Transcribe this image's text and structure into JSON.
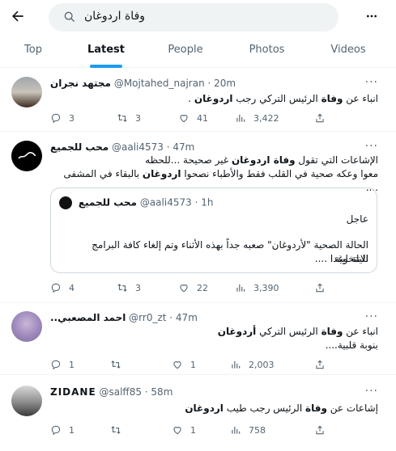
{
  "search": {
    "query": "وفاة اردوغان"
  },
  "tabs": [
    {
      "label": "Top"
    },
    {
      "label": "Latest"
    },
    {
      "label": "People"
    },
    {
      "label": "Photos"
    },
    {
      "label": "Videos"
    }
  ],
  "colors": {
    "accent": "#1d9bf0",
    "text": "#0f1419",
    "muted": "#536471"
  },
  "tweets": [
    {
      "name": "مجتهد نجران",
      "handle": "@Mojtahed_najran",
      "time": "· 20m",
      "text_parts": [
        "انباء عن ",
        "وفاة",
        " الرئيس التركي رجب ",
        "اردوغان",
        " ."
      ],
      "replies": "3",
      "retweets": "3",
      "likes": "41",
      "views": "3,422"
    },
    {
      "name": "محب للجميع",
      "handle": "@aali4573",
      "time": "· 47m",
      "text_parts": [
        "الإشاعات التي تقول ",
        "وفاة اردوغان",
        " غير صحيحة ...للحظه",
        "معوا وعكه صحية في القلب فقط والأطباء نصحوا ",
        "اردوغان",
        " بالبقاء في المشفى ...."
      ],
      "quote": {
        "name": "محب للجميع",
        "handle": "@aali4573",
        "time": "· 1h",
        "line1": "عاجل",
        "line2": "الحالة الصحية \"لأردوغان\"  صعبه جداً بهذه الأثناء وتم إلغاء كافة البرامج الانتخابية",
        "line3": "لليلة وغدا ...."
      },
      "replies": "4",
      "retweets": "3",
      "likes": "22",
      "views": "3,390"
    },
    {
      "name": "..احمد المصعبي",
      "handle": "@rr0_zt",
      "time": "· 47m",
      "text_parts": [
        "انباء عن ",
        "وفاة",
        " الرئيس التركي ",
        "أردوغان"
      ],
      "line2": "بنوبة قلبية....",
      "replies": "1",
      "retweets": "",
      "likes": "1",
      "views": "2,003"
    },
    {
      "name": "ZIDANE",
      "handle": "@salff85",
      "time": "· 58m",
      "text_parts": [
        "إشاعات عن ",
        "وفاة",
        " الرئيس رجب طيب ",
        "اردوغان"
      ],
      "replies": "1",
      "retweets": "",
      "likes": "1",
      "views": "758"
    }
  ]
}
